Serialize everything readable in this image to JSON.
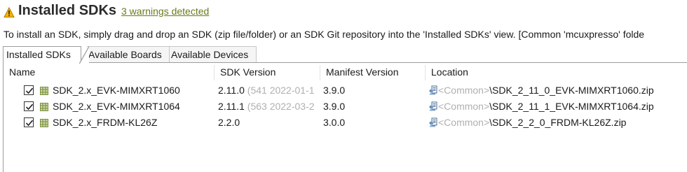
{
  "header": {
    "title": "Installed SDKs",
    "warnings_link": "3 warnings detected",
    "warning_icon": "warning-triangle-icon",
    "warning_color": "#e8a317"
  },
  "instructions": "To install an SDK, simply drag and drop an SDK (zip file/folder) or an SDK Git repository into the 'Installed SDKs' view. [Common 'mcuxpresso' folde",
  "tabs": [
    {
      "label": "Installed SDKs",
      "active": true
    },
    {
      "label": "Available Boards",
      "active": false
    },
    {
      "label": "Available Devices",
      "active": false
    }
  ],
  "table": {
    "columns": [
      "Name",
      "SDK Version",
      "Manifest Version",
      "Location"
    ],
    "rows": [
      {
        "checked": true,
        "name": "SDK_2.x_EVK-MIMXRT1060",
        "version": "2.11.0",
        "version_build": "(541 2022-01-1",
        "manifest": "3.9.0",
        "location_var": "<Common>",
        "location_path": "\\SDK_2_11_0_EVK-MIMXRT1060.zip"
      },
      {
        "checked": true,
        "name": "SDK_2.x_EVK-MIMXRT1064",
        "version": "2.11.1",
        "version_build": "(563 2022-03-2",
        "manifest": "3.9.0",
        "location_var": "<Common>",
        "location_path": "\\SDK_2_11_1_EVK-MIMXRT1064.zip"
      },
      {
        "checked": true,
        "name": "SDK_2.x_FRDM-KL26Z",
        "version": "2.2.0",
        "version_build": "",
        "manifest": "3.0.0",
        "location_var": "<Common>",
        "location_path": "\\SDK_2_2_0_FRDM-KL26Z.zip"
      }
    ]
  }
}
